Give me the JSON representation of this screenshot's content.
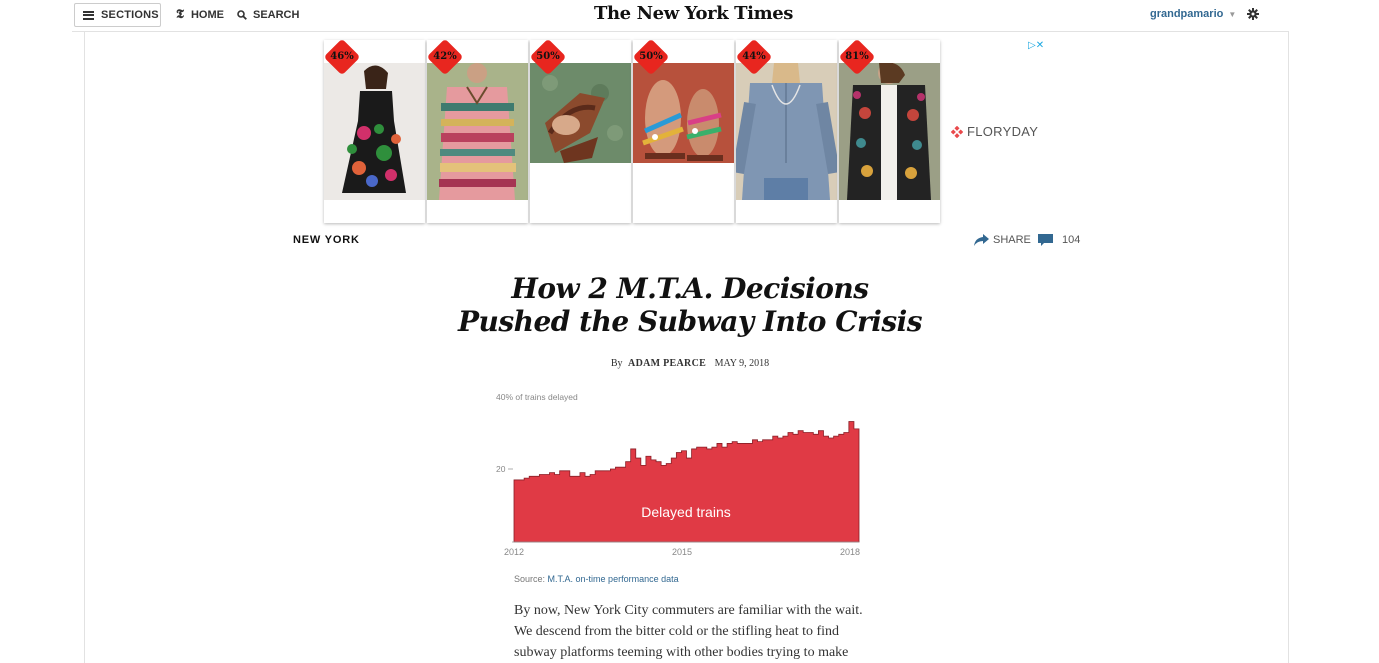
{
  "topbar": {
    "sections_label": "SECTIONS",
    "home_label": "HOME",
    "search_label": "SEARCH",
    "masthead": "The New York Times",
    "username": "grandpamario"
  },
  "ad": {
    "brand": "FLORYDAY",
    "products": [
      {
        "discount": "46%",
        "icon": "black-floral-dress-photo"
      },
      {
        "discount": "42%",
        "icon": "striped-tribal-top-photo"
      },
      {
        "discount": "50%",
        "icon": "brown-sandals-photo"
      },
      {
        "discount": "50%",
        "icon": "beaded-sandals-photo"
      },
      {
        "discount": "44%",
        "icon": "blue-blouse-photo"
      },
      {
        "discount": "81%",
        "icon": "embroidered-jacket-photo"
      }
    ]
  },
  "article": {
    "section": "NEW YORK",
    "share_label": "SHARE",
    "comment_count": "104",
    "headline_line1": "How 2 M.T.A. Decisions",
    "headline_line2": "Pushed the Subway Into Crisis",
    "by": "By",
    "author": "ADAM PEARCE",
    "date": "MAY 9, 2018",
    "source_prefix": "Source:",
    "source_link": "M.T.A. on-time performance data",
    "body_lines": [
      "By now, New York City commuters are familiar with the wait.",
      "We descend from the bitter cold or the stifling heat to find",
      "subway platforms teeming with other bodies trying to make"
    ]
  },
  "chart_data": {
    "type": "area",
    "series": [
      {
        "name": "Delayed trains",
        "color": "#e03a45"
      }
    ],
    "x_start": 2012,
    "x_end": 2018.3,
    "values": [
      17,
      17,
      17.5,
      18,
      18,
      18.5,
      18.5,
      19,
      18.5,
      19.5,
      19.5,
      18,
      18,
      19,
      18,
      18.5,
      19.5,
      19.5,
      19.5,
      20,
      20.5,
      20.5,
      22,
      25.5,
      23,
      21,
      23.5,
      22.5,
      22,
      21,
      21.5,
      23,
      24.5,
      25,
      23,
      25.5,
      26,
      26,
      25.5,
      26,
      27,
      26,
      27,
      27.5,
      27,
      27,
      27,
      28,
      27.5,
      28,
      28,
      29,
      28.5,
      29,
      30,
      29.5,
      30.5,
      30,
      30,
      29.5,
      30.5,
      29,
      28.5,
      29,
      29.5,
      30,
      33,
      31
    ],
    "ylim": [
      0,
      40
    ],
    "yticks": [
      "20",
      "40% of trains delayed"
    ],
    "xticks": [
      "2012",
      "2015",
      "2018"
    ],
    "label": "Delayed trains",
    "color": "#e03a45"
  }
}
